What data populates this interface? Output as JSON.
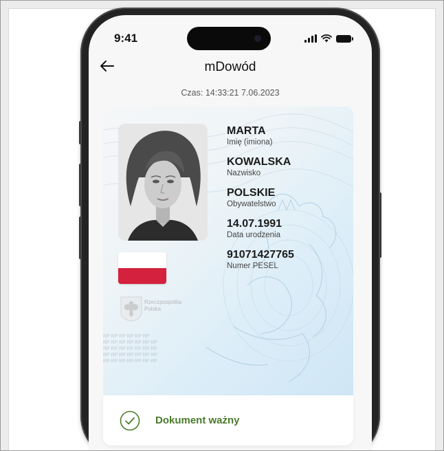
{
  "status_bar": {
    "time": "9:41"
  },
  "header": {
    "title": "mDowód"
  },
  "timestamp": "Czas: 14:33:21 7.06.2023",
  "id_card": {
    "emblem_text": [
      "Rzeczpospolita",
      "Polska"
    ],
    "fields": [
      {
        "value": "MARTA",
        "label": "Imię (imiona)"
      },
      {
        "value": "KOWALSKA",
        "label": "Nazwisko"
      },
      {
        "value": "POLSKIE",
        "label": "Obywatelstwo"
      },
      {
        "value": "14.07.1991",
        "label": "Data urodzenia"
      },
      {
        "value": "91071427765",
        "label": "Numer PESEL"
      }
    ],
    "microprint": "RP RP RP RP RP RP\nRP RP RP RP RP RP RP\nRP RP RP RP RP RP RP\nRP RP RP RP RP RP RP\nRP RP RP RP RP RP RP"
  },
  "validity": {
    "label": "Dokument ważny",
    "color": "#4a7a2a"
  },
  "icons": [
    "back-arrow-icon",
    "signal-icon",
    "wifi-icon",
    "battery-icon",
    "checkmark-circle-icon",
    "eagle-emblem-icon"
  ]
}
